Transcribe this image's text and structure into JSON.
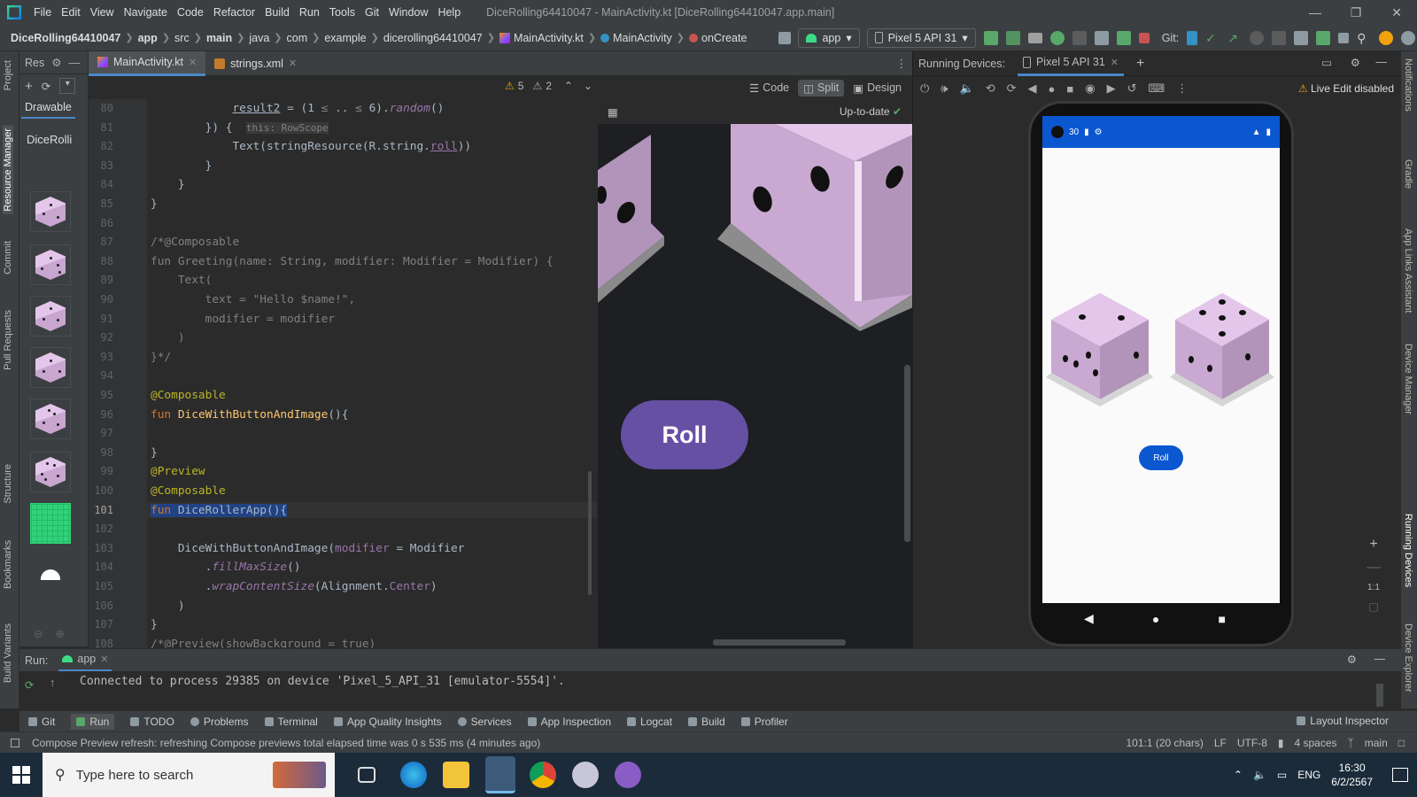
{
  "menu": {
    "items": [
      "File",
      "Edit",
      "View",
      "Navigate",
      "Code",
      "Refactor",
      "Build",
      "Run",
      "Tools",
      "Git",
      "Window",
      "Help"
    ],
    "title": "DiceRolling64410047 - MainActivity.kt [DiceRolling64410047.app.main]"
  },
  "nav": {
    "crumbs": [
      "DiceRolling64410047",
      "app",
      "src",
      "main",
      "java",
      "com",
      "example",
      "dicerolling64410047",
      "MainActivity.kt",
      "MainActivity",
      "onCreate"
    ],
    "run_config": "app",
    "device": "Pixel 5 API 31",
    "git_label": "Git:"
  },
  "resource_panel": {
    "header": "Res",
    "tab": "Drawable",
    "filter": "DiceRolli"
  },
  "left_strip": [
    "Project",
    "Resource Manager",
    "Commit",
    "Pull Requests",
    "Structure",
    "Bookmarks",
    "Build Variants"
  ],
  "right_strip": [
    "Notifications",
    "Gradle",
    "App Links Assistant",
    "Device Manager",
    "Running Devices",
    "Device Explorer"
  ],
  "editor_tabs": [
    "MainActivity.kt",
    "strings.xml"
  ],
  "view_modes": [
    "Code",
    "Split",
    "Design"
  ],
  "inspection": {
    "warnings": "5",
    "weak": "2"
  },
  "preview": {
    "status": "Up-to-date",
    "button": "Roll"
  },
  "code_lines": [
    {
      "n": "80",
      "html": "            <u>result2</u> = (1 <span class='cm'>≤</span> .. <span class='cm'>≤</span> 6).<span class='it'>random</span>()"
    },
    {
      "n": "81",
      "html": "        }) {  <span class='cm' style='background:#3a3a3a;font-size:11px'>this: RowScope</span>"
    },
    {
      "n": "82",
      "html": "            Text(stringResource(R.string.<span class='pr'><u>roll</u></span>))"
    },
    {
      "n": "83",
      "html": "        }"
    },
    {
      "n": "84",
      "html": "    }"
    },
    {
      "n": "85",
      "html": "}"
    },
    {
      "n": "86",
      "html": ""
    },
    {
      "n": "87",
      "html": "<span class='cm'>/*@Composable</span>"
    },
    {
      "n": "88",
      "html": "<span class='cm'>fun Greeting(name: String, modifier: Modifier = Modifier) {</span>"
    },
    {
      "n": "89",
      "html": "<span class='cm'>    Text(</span>"
    },
    {
      "n": "90",
      "html": "<span class='cm'>        text = \"Hello $name!\",</span>"
    },
    {
      "n": "91",
      "html": "<span class='cm'>        modifier = modifier</span>"
    },
    {
      "n": "92",
      "html": "<span class='cm'>    )</span>"
    },
    {
      "n": "93",
      "html": "<span class='cm'>}*/</span>"
    },
    {
      "n": "94",
      "html": ""
    },
    {
      "n": "95",
      "html": "<span class='an'>@Composable</span>"
    },
    {
      "n": "96",
      "html": "<span class='kw'>fun</span> <span class='fn'>DiceWithButtonAndImage</span>(){"
    },
    {
      "n": "97",
      "html": ""
    },
    {
      "n": "98",
      "html": "}"
    },
    {
      "n": "99",
      "html": "<span class='an'>@Preview</span>"
    },
    {
      "n": "100",
      "html": "<span class='an'>@Composable</span>"
    },
    {
      "n": "101",
      "html": "<span style='background:#214283'><span class='kw'>fun</span> DiceRollerApp(){</span>"
    },
    {
      "n": "102",
      "html": ""
    },
    {
      "n": "103",
      "html": "    DiceWithButtonAndImage(<span class='pr'>modifier</span> = Modifier"
    },
    {
      "n": "104",
      "html": "        .<span class='it'>fillMaxSize</span>()"
    },
    {
      "n": "105",
      "html": "        .<span class='it'>wrapContentSize</span>(Alignment.<span class='pr'>Center</span>)"
    },
    {
      "n": "106",
      "html": "    )"
    },
    {
      "n": "107",
      "html": "}"
    },
    {
      "n": "108",
      "html": "<span class='cm'>/*@Preview(showBackground = true)</span>"
    }
  ],
  "running_devices": {
    "label": "Running Devices:",
    "tab": "Pixel 5 API 31",
    "live_edit": "Live Edit disabled",
    "phone_status_time": "30",
    "app_button": "Roll",
    "zoom_label": "1:1"
  },
  "run_panel": {
    "label": "Run:",
    "tab": "app",
    "console": "Connected to process 29385 on device 'Pixel_5_API_31 [emulator-5554]'."
  },
  "bottom_tabs": [
    "Git",
    "Run",
    "TODO",
    "Problems",
    "Terminal",
    "App Quality Insights",
    "Services",
    "App Inspection",
    "Logcat",
    "Build",
    "Profiler"
  ],
  "layout_inspector": "Layout Inspector",
  "status": {
    "message": "Compose Preview refresh: refreshing Compose previews total elapsed time was 0 s 535 ms (4 minutes ago)",
    "position": "101:1 (20 chars)",
    "line_sep": "LF",
    "encoding": "UTF-8",
    "indent": "4 spaces",
    "branch": "main"
  },
  "taskbar": {
    "search_placeholder": "Type here to search",
    "lang": "ENG",
    "time": "16:30",
    "date": "6/2/2567"
  }
}
